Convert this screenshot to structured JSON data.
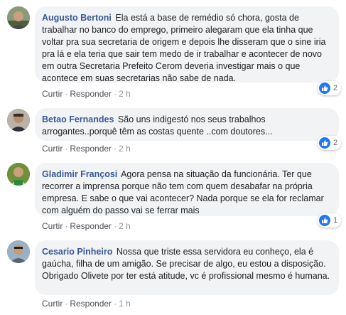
{
  "colors": {
    "author_link": "#385898",
    "bubble_bg": "#f2f3f5",
    "like_blue": "#2078f4",
    "meta_text": "#90949c"
  },
  "comments": [
    {
      "author": "Augusto Bertoni",
      "text": "Ela está a base de remédio só chora, gosta de trabalhar no banco do emprego, primeiro alegaram que ela tinha que voltar pra sua secretaria de origem e depois lhe disseram que o sine iria pra lá e ela teria que sair tem medo de ir trabalhar e acontecer de novo em outra Secretaria Prefeito Cerom deveria investigar mais o que acontece em suas secretarias não sabe de nada.",
      "like_label": "Curtir",
      "reply_label": "Responder",
      "separator": "·",
      "time": "2 h",
      "reaction_icon": "like-icon",
      "reaction_count": "2"
    },
    {
      "author": "Betao Fernandes",
      "text": "São uns indigestó nos seus trabalhos arrogantes..porquê têm as costas quente ..com doutores...",
      "like_label": "Curtir",
      "reply_label": "Responder",
      "separator": "·",
      "time": "2 h",
      "reaction_icon": "like-icon",
      "reaction_count": "2"
    },
    {
      "author": "Gladimir Françosi",
      "text": "Agora pensa na situação da funcionária. Ter que recorrer a imprensa porque não tem com quem desabafar na própria empresa. E sabe o que vai acontecer? Nada porque se ela for reclamar com alguém do passo vai se ferrar mais",
      "like_label": "Curtir",
      "reply_label": "Responder",
      "separator": "·",
      "time": "2 h",
      "reaction_icon": "like-icon",
      "reaction_count": "1"
    },
    {
      "author": "Cesario Pinheiro",
      "text": "Nossa que triste essa servidora eu conheço, ela é gaúcha, filha de um amigão. Se precisar de algo, eu estou a disposição. Obrigado Olivete por ter está atitude, vc é profissional mesmo é humana.",
      "like_label": "Curtir",
      "reply_label": "Responder",
      "separator": "·",
      "time": "1 h"
    }
  ]
}
